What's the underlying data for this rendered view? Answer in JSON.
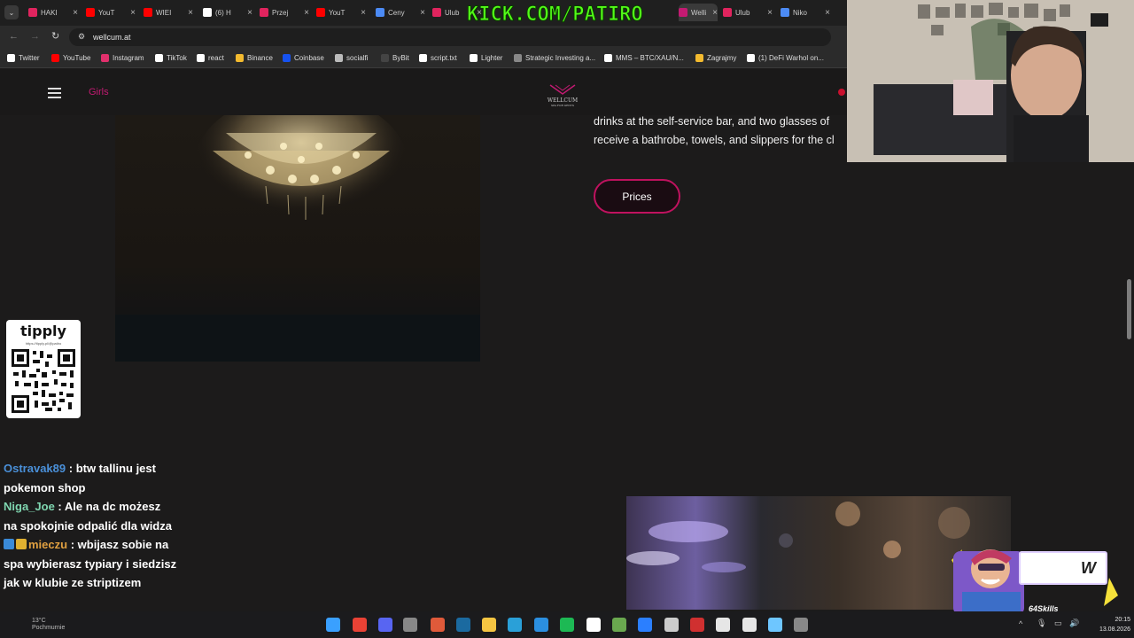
{
  "browser": {
    "tabs": [
      {
        "label": "HAKI",
        "color": "#e0245e"
      },
      {
        "label": "YouT",
        "color": "#ff0000"
      },
      {
        "label": "WIEI",
        "color": "#ff0000"
      },
      {
        "label": "(6) H",
        "color": "#ffffff"
      },
      {
        "label": "Przej",
        "color": "#e0245e"
      },
      {
        "label": "YouT",
        "color": "#ff0000"
      },
      {
        "label": "Ceny",
        "color": "#4c8bf5"
      },
      {
        "label": "Ulub",
        "color": "#e0245e"
      },
      {
        "label": "Welli",
        "color": "#c31a72"
      },
      {
        "label": "Ulub",
        "color": "#e0245e"
      },
      {
        "label": "Niko",
        "color": "#4c8bf5"
      }
    ],
    "kick_overlay": "KICK.COM/PATIRO",
    "url": "wellcum.at",
    "bookmarks": [
      {
        "label": "Twitter",
        "color": "#ffffff"
      },
      {
        "label": "YouTube",
        "color": "#ff0000"
      },
      {
        "label": "Instagram",
        "color": "#e1306c"
      },
      {
        "label": "TikTok",
        "color": "#ffffff"
      },
      {
        "label": "react",
        "color": "#ffffff"
      },
      {
        "label": "Binance",
        "color": "#f3ba2f"
      },
      {
        "label": "Coinbase",
        "color": "#1652f0"
      },
      {
        "label": "socialfi",
        "color": "#bbbbbb"
      },
      {
        "label": "ByBit",
        "color": "#444444"
      },
      {
        "label": "script.txt",
        "color": "#ffffff"
      },
      {
        "label": "Lighter",
        "color": "#ffffff"
      },
      {
        "label": "Strategic Investing a...",
        "color": "#888888"
      },
      {
        "label": "MMS – BTC/XAU/N...",
        "color": "#ffffff"
      },
      {
        "label": "Zagrajmy",
        "color": "#f3ba2f"
      },
      {
        "label": "(1) DeFi Warhol on...",
        "color": "#ffffff"
      }
    ]
  },
  "site": {
    "nav_link": "Girls",
    "logo_text": "WELLCUM",
    "logo_sub": "SPA FOR GENTS",
    "description_line1": "drinks at the self-service bar, and two glasses of",
    "description_line2": "receive a bathrobe, towels, and slippers for the cl",
    "prices_button": "Prices",
    "accent_color": "#c0125f"
  },
  "tipply": {
    "title": "tipply",
    "url": "https://tipply.pl/@patiro"
  },
  "chat": [
    {
      "user": "Ostravak89",
      "user_color": "#4a90d9",
      "text": "btw tallinu jest pokemon shop",
      "badges": []
    },
    {
      "user": "Niga_Joe",
      "user_color": "#7fd6b0",
      "text": "Ale na dc możesz na spokojnie odpalić dla widza",
      "badges": []
    },
    {
      "user": "mieczu",
      "user_color": "#e0a040",
      "text": "wbijasz sobie na spa wybierasz typiary i siedzisz jak w klubie ze striptizem",
      "badges": [
        "play",
        "crown"
      ]
    }
  ],
  "overlay_card": {
    "letter": "W"
  },
  "taskbar": {
    "weather_temp": "13°C",
    "weather_desc": "Pochmurnie",
    "time": "20:15",
    "date": "13.08.2026"
  }
}
